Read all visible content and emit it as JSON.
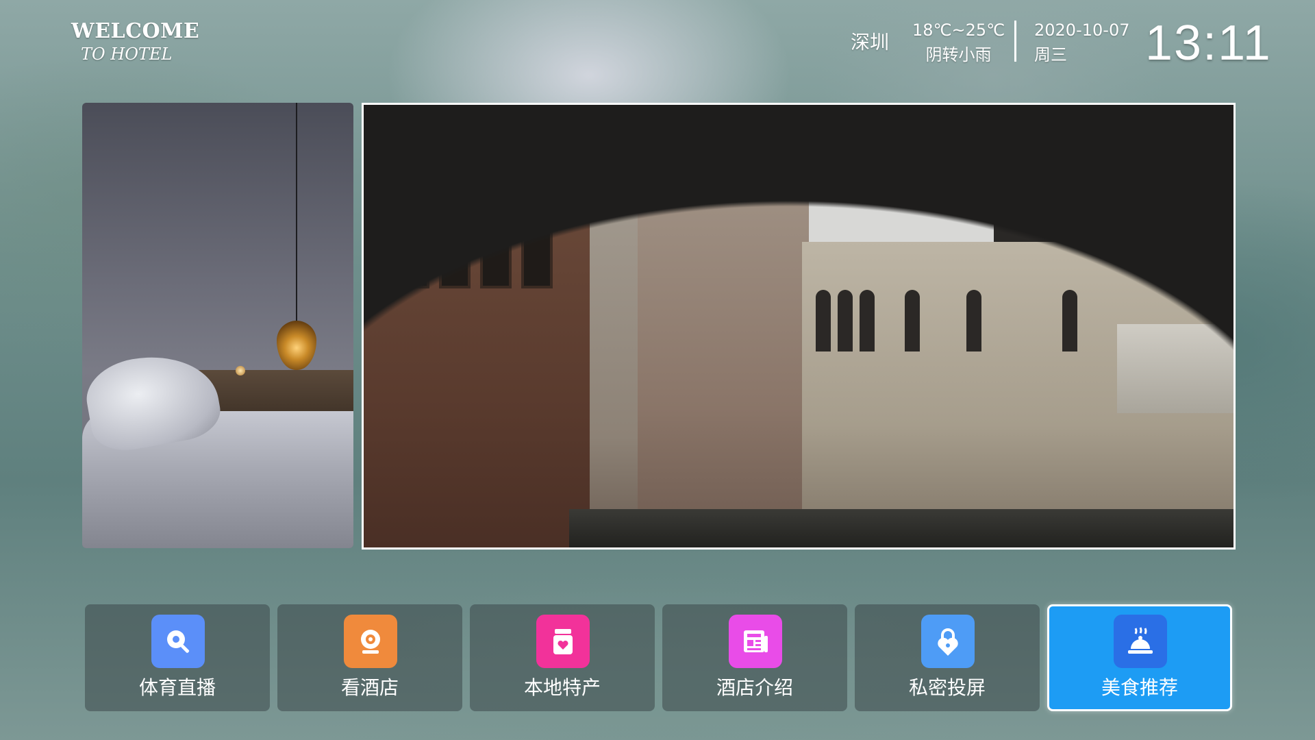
{
  "logo": {
    "line1": "WELCOME",
    "line2": "TO HOTEL"
  },
  "status": {
    "city": "深圳",
    "temperature": "18℃~25℃",
    "weather": "阴转小雨",
    "date": "2020-10-07",
    "weekday": "周三",
    "time": "13:11"
  },
  "nav": {
    "items": [
      {
        "label": "体育直播",
        "icon": "sports-live-icon",
        "color": "#5b8ff9"
      },
      {
        "label": "看酒店",
        "icon": "camera-icon",
        "color": "#f08a3c"
      },
      {
        "label": "本地特产",
        "icon": "gift-jar-icon",
        "color": "#f2329a"
      },
      {
        "label": "酒店介绍",
        "icon": "newspaper-icon",
        "color": "#e94ce8"
      },
      {
        "label": "私密投屏",
        "icon": "lock-icon",
        "color": "#4e9cf6"
      },
      {
        "label": "美食推荐",
        "icon": "food-cloche-icon",
        "color": "#2a6fe6"
      }
    ],
    "active_index": 5,
    "active_color": "#1d9cf4"
  }
}
